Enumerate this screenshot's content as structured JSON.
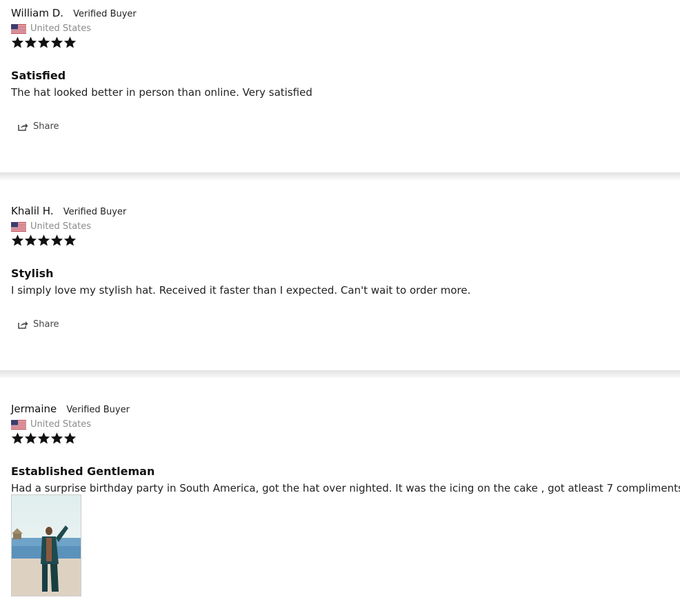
{
  "reviews": [
    {
      "name": "William D.",
      "badge": "Verified Buyer",
      "location": "United States",
      "rating": 5,
      "title": "Satisfied",
      "body": "The hat looked better in person than online. Very satisfied",
      "share_label": "Share"
    },
    {
      "name": "Khalil H.",
      "badge": "Verified Buyer",
      "location": "United States",
      "rating": 5,
      "title": "Stylish",
      "body": "I simply love my stylish hat. Received it faster than I expected. Can't wait to order more.",
      "share_label": "Share"
    },
    {
      "name": "Jermaine",
      "badge": "Verified Buyer",
      "location": "United States",
      "rating": 5,
      "title": "Established Gentleman",
      "body": "Had a surprise birthday party in South America, got the hat over nighted. It was the icing on the cake , got atleast 7 compliments!!",
      "has_photo": true
    }
  ],
  "icons": {
    "flag": "us-flag-icon",
    "star": "star-icon",
    "share": "share-icon"
  },
  "colors": {
    "star": "#111111",
    "location": "#8a8a8a",
    "divider": "#e2e2e2"
  }
}
